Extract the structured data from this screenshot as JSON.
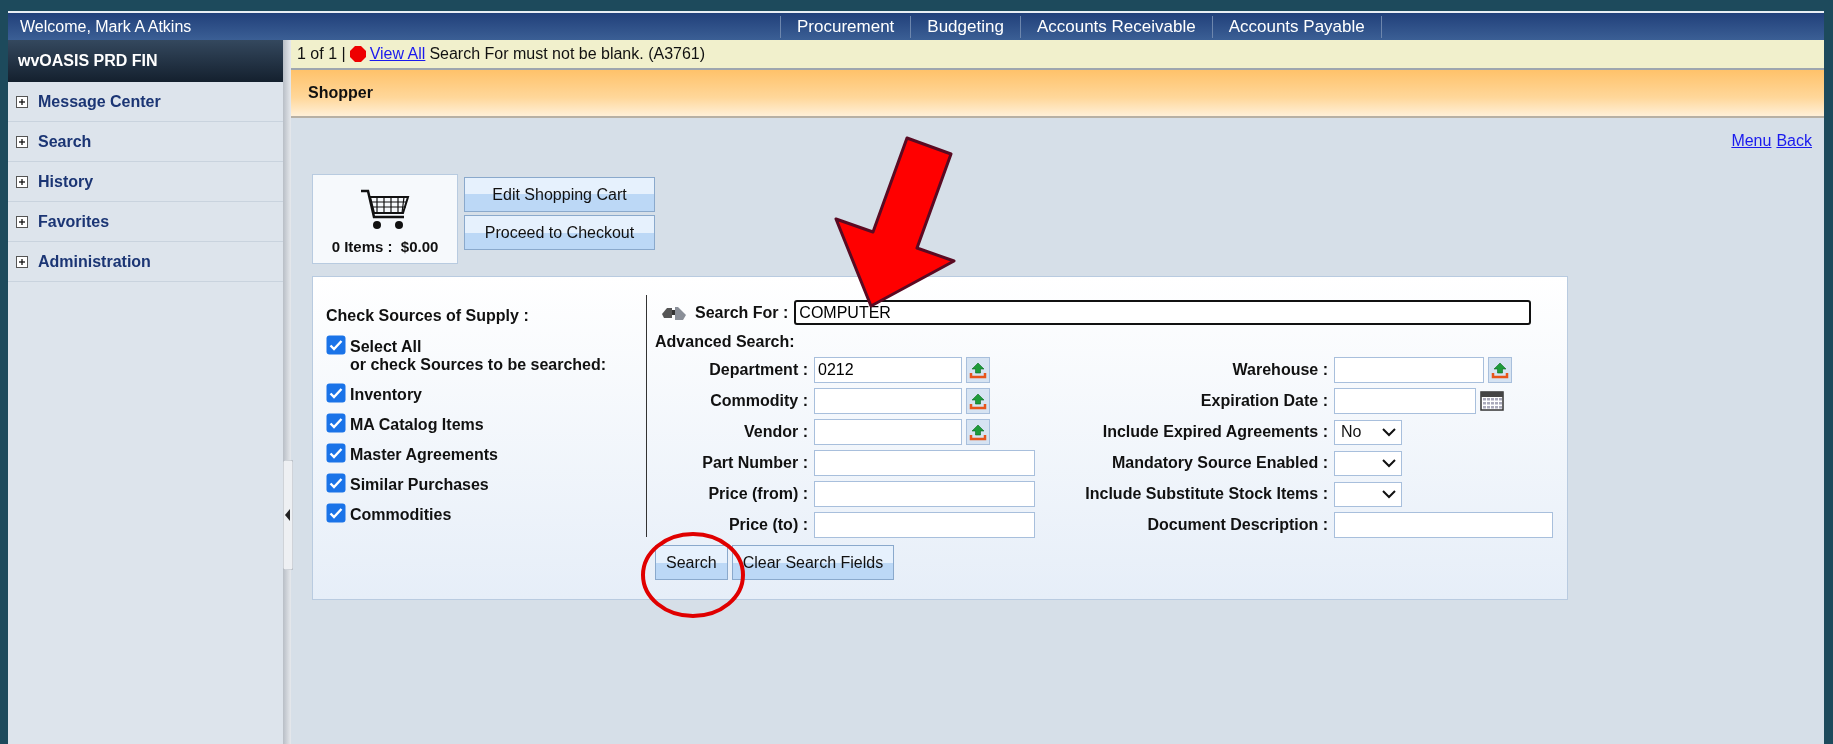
{
  "header": {
    "welcome": "Welcome, Mark A Atkins",
    "nav": [
      "Procurement",
      "Budgeting",
      "Accounts Receivable",
      "Accounts Payable"
    ]
  },
  "sidebar": {
    "title": "wvOASIS PRD FIN",
    "items": [
      {
        "label": "Message Center",
        "expanded": false
      },
      {
        "label": "Search",
        "expanded": false
      },
      {
        "label": "History",
        "expanded": false
      },
      {
        "label": "Favorites",
        "expanded": false
      },
      {
        "label": "Administration",
        "expanded": false
      }
    ]
  },
  "message_bar": {
    "count": "1 of 1 |",
    "link": "View All",
    "message": "Search For must not be blank. (A3761)"
  },
  "page_title": "Shopper",
  "top_links": [
    "Menu",
    "Back"
  ],
  "cart": {
    "summary": "0 Items :  $0.00",
    "buttons": [
      "Edit Shopping Cart",
      "Proceed to Checkout"
    ]
  },
  "sources": {
    "title": "Check Sources of Supply :",
    "items": [
      {
        "label": "Select All",
        "note": "or check Sources to be searched:",
        "checked": true
      },
      {
        "label": "Inventory",
        "checked": true
      },
      {
        "label": "MA Catalog Items",
        "checked": true
      },
      {
        "label": "Master Agreements",
        "checked": true
      },
      {
        "label": "Similar Purchases",
        "checked": true
      },
      {
        "label": "Commodities",
        "checked": true
      }
    ]
  },
  "search_for": {
    "label": "Search For :",
    "value": "COMPUTER"
  },
  "advanced_title": "Advanced Search:",
  "left_fields": [
    {
      "label": "Department :",
      "kind": "lookup",
      "value": "0212"
    },
    {
      "label": "Commodity :",
      "kind": "lookup"
    },
    {
      "label": "Vendor :",
      "kind": "lookup"
    },
    {
      "label": "Part Number :",
      "kind": "text"
    },
    {
      "label": "Price (from) :",
      "kind": "text"
    },
    {
      "label": "Price (to) :",
      "kind": "text"
    }
  ],
  "right_fields": [
    {
      "label": "Warehouse :",
      "kind": "lookup"
    },
    {
      "label": "Expiration Date :",
      "kind": "date"
    },
    {
      "label": "Include Expired Agreements :",
      "kind": "select",
      "value": "No"
    },
    {
      "label": "Mandatory Source Enabled :",
      "kind": "select"
    },
    {
      "label": "Include Substitute Stock Items :",
      "kind": "select"
    },
    {
      "label": "Document Description :",
      "kind": "wide"
    }
  ],
  "buttons": [
    "Search",
    "Clear Search Fields"
  ]
}
